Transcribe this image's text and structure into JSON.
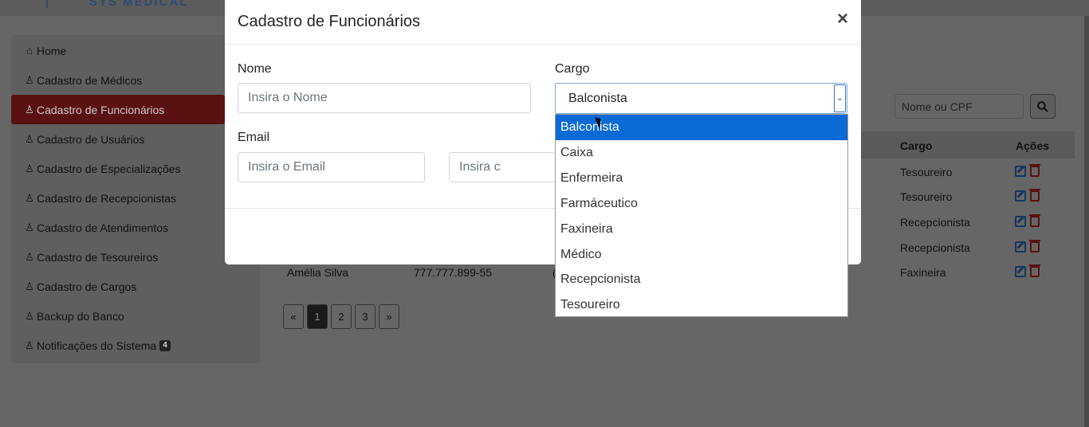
{
  "brand": {
    "name": "SYS MEDICAL"
  },
  "sidebar": {
    "items": [
      {
        "label": "Home",
        "icon": "home-icon"
      },
      {
        "label": "Cadastro de Médicos",
        "icon": "user-md-icon"
      },
      {
        "label": "Cadastro de Funcionários",
        "icon": "user-icon",
        "active": true
      },
      {
        "label": "Cadastro de Usuários",
        "icon": "user-icon"
      },
      {
        "label": "Cadastro de Especializações",
        "icon": "user-icon"
      },
      {
        "label": "Cadastro de Recepcionistas",
        "icon": "user-icon"
      },
      {
        "label": "Cadastro de Atendimentos",
        "icon": "user-icon"
      },
      {
        "label": "Cadastro de Tesoureiros",
        "icon": "user-icon"
      },
      {
        "label": "Cadastro de Cargos",
        "icon": "user-icon"
      },
      {
        "label": "Backup do Banco",
        "icon": "user-icon"
      },
      {
        "label": "Notificações do Sistema",
        "icon": "user-icon",
        "badge": "4"
      }
    ]
  },
  "search": {
    "placeholder": "Nome ou CPF"
  },
  "table": {
    "headers": {
      "cargo": "Cargo",
      "acoes": "Ações"
    },
    "rows": [
      {
        "cargo": "Tesoureiro"
      },
      {
        "cargo": "Tesoureiro"
      },
      {
        "cargo": "Recepcionista"
      },
      {
        "cargo": "Recepcionista"
      },
      {
        "nome": "Amélia Silva",
        "cpf": "777.777.899-55",
        "partial": "(",
        "cargo": "Faxineira"
      }
    ]
  },
  "pagination": {
    "prev": "«",
    "pages": [
      "1",
      "2",
      "3"
    ],
    "next": "»",
    "current": "1"
  },
  "modal": {
    "title": "Cadastro de Funcionários",
    "close": "×",
    "nome_label": "Nome",
    "nome_placeholder": "Insira o Nome",
    "cargo_label": "Cargo",
    "cargo_value": "Balconista",
    "email_label": "Email",
    "email_placeholder": "Insira o Email",
    "partial_placeholder": "Insira c",
    "cargo_options": [
      "Balconista",
      "Caixa",
      "Enfermeira",
      "Farmáceutico",
      "Faxineira",
      "Médico",
      "Recepcionista",
      "Tesoureiro"
    ]
  }
}
